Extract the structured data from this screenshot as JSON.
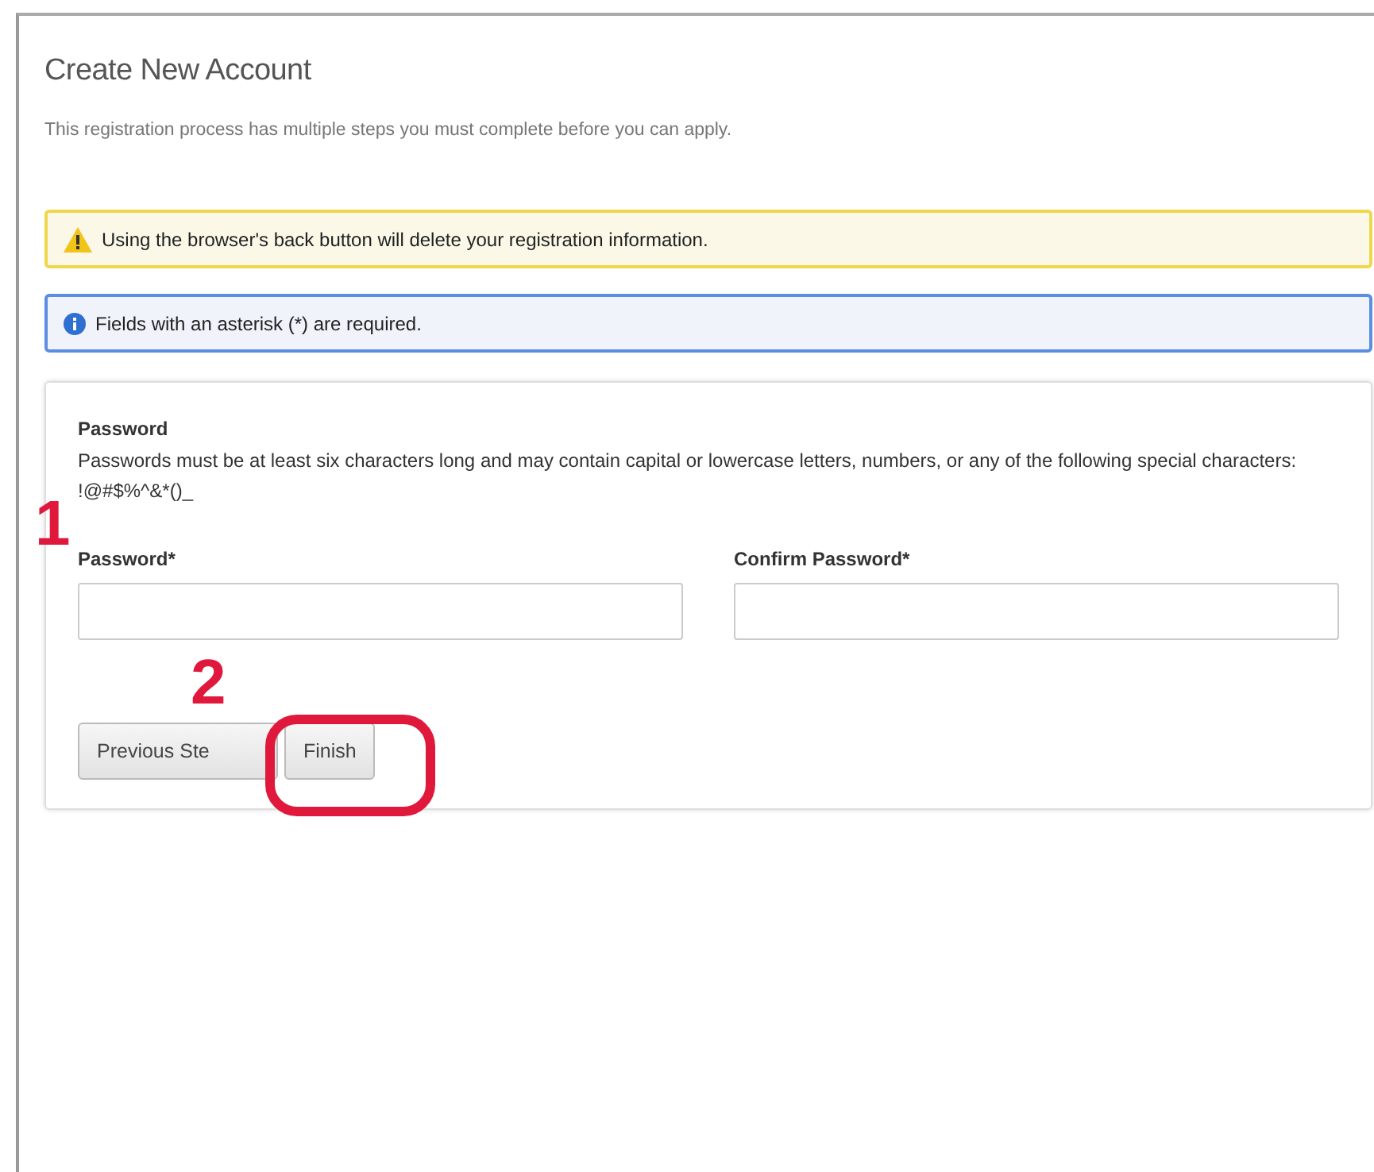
{
  "page": {
    "title": "Create New Account",
    "subtitle": "This registration process has multiple steps you must complete before you can apply."
  },
  "alerts": [
    {
      "kind": "warning",
      "text": "Using the browser's back button will delete your registration information."
    },
    {
      "kind": "info",
      "text": "Fields with an asterisk (*) are required."
    }
  ],
  "form": {
    "heading": "Password",
    "description": "Passwords must be at least six characters long and may contain capital or lowercase letters, numbers, or any of the following special characters: !@#$%^&*()_",
    "fields": [
      {
        "label": "Password*"
      },
      {
        "label": "Confirm Password*"
      }
    ],
    "buttons": [
      {
        "label": "Previous Ste"
      },
      {
        "label": "Finish"
      }
    ]
  },
  "annotations": [
    {
      "kind": "number",
      "text": "1"
    },
    {
      "kind": "number",
      "text": "2"
    },
    {
      "kind": "ring"
    }
  ]
}
